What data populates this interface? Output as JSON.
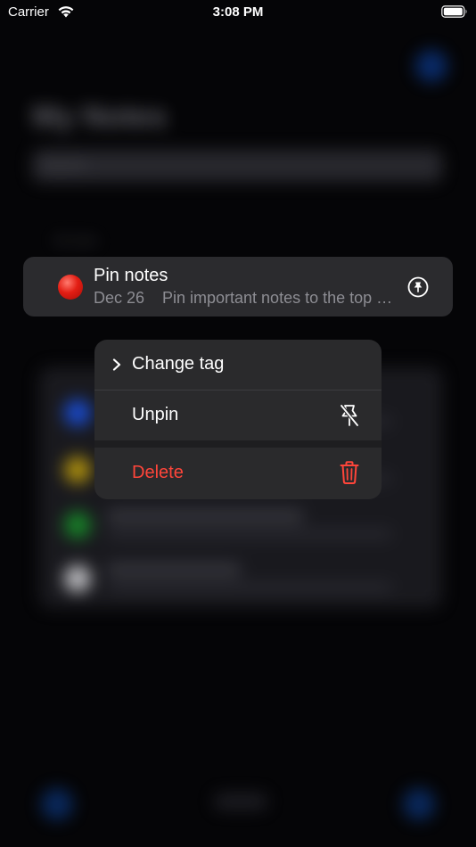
{
  "status_bar": {
    "carrier": "Carrier",
    "time": "3:08 PM"
  },
  "background": {
    "title": "My Notes",
    "search_placeholder": "Search",
    "section_label": "All notes"
  },
  "note_card": {
    "title": "Pin notes",
    "date": "Dec 26",
    "preview": "Pin important notes to the top of the list",
    "tag_color": "#e31e14",
    "pin_icon": "pin-icon"
  },
  "context_menu": {
    "items": [
      {
        "label": "Change tag",
        "icon": "chevron-right-icon"
      },
      {
        "label": "Unpin",
        "icon": "pin-slash-icon"
      },
      {
        "label": "Delete",
        "icon": "trash-icon",
        "destructive": true
      }
    ]
  },
  "colors": {
    "accent_destructive": "#ff453a",
    "menu_background": "#2a2a2c",
    "card_background": "#2b2b2e"
  }
}
